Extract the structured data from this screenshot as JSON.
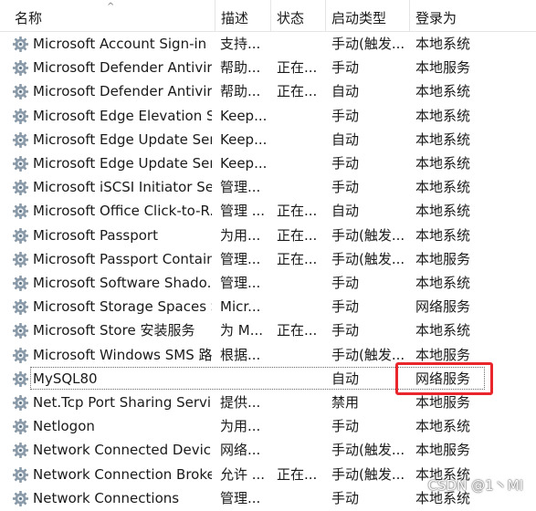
{
  "columns": {
    "name": "名称",
    "desc": "描述",
    "status": "状态",
    "startup": "启动类型",
    "logon": "登录为"
  },
  "sort_indicator": "^",
  "services": [
    {
      "name": "Microsoft Account Sign-in ...",
      "desc": "支持...",
      "status": "",
      "startup": "手动(触发...",
      "logon": "本地系统"
    },
    {
      "name": "Microsoft Defender Antivir...",
      "desc": "帮助...",
      "status": "正在...",
      "startup": "手动",
      "logon": "本地服务"
    },
    {
      "name": "Microsoft Defender Antivir...",
      "desc": "帮助...",
      "status": "正在...",
      "startup": "自动",
      "logon": "本地系统"
    },
    {
      "name": "Microsoft Edge Elevation S...",
      "desc": "Keep...",
      "status": "",
      "startup": "手动",
      "logon": "本地系统"
    },
    {
      "name": "Microsoft Edge Update Ser...",
      "desc": "Keep...",
      "status": "",
      "startup": "自动",
      "logon": "本地系统"
    },
    {
      "name": "Microsoft Edge Update Ser...",
      "desc": "Keep...",
      "status": "",
      "startup": "手动",
      "logon": "本地系统"
    },
    {
      "name": "Microsoft iSCSI Initiator Ser...",
      "desc": "管理...",
      "status": "",
      "startup": "手动",
      "logon": "本地系统"
    },
    {
      "name": "Microsoft Office Click-to-R...",
      "desc": "管理 ...",
      "status": "正在...",
      "startup": "自动",
      "logon": "本地系统"
    },
    {
      "name": "Microsoft Passport",
      "desc": "为用...",
      "status": "正在...",
      "startup": "手动(触发...",
      "logon": "本地系统"
    },
    {
      "name": "Microsoft Passport Container",
      "desc": "管理...",
      "status": "正在...",
      "startup": "手动(触发...",
      "logon": "本地服务"
    },
    {
      "name": "Microsoft Software Shado...",
      "desc": "管理...",
      "status": "",
      "startup": "手动",
      "logon": "本地系统"
    },
    {
      "name": "Microsoft Storage Spaces S...",
      "desc": "Micr...",
      "status": "",
      "startup": "手动",
      "logon": "网络服务"
    },
    {
      "name": "Microsoft Store 安装服务",
      "desc": "为 M...",
      "status": "正在...",
      "startup": "手动",
      "logon": "本地系统"
    },
    {
      "name": "Microsoft Windows SMS 路...",
      "desc": "根据...",
      "status": "",
      "startup": "手动(触发...",
      "logon": "本地服务"
    },
    {
      "name": "MySQL80",
      "desc": "",
      "status": "",
      "startup": "自动",
      "logon": "网络服务"
    },
    {
      "name": "Net.Tcp Port Sharing Service",
      "desc": "提供...",
      "status": "",
      "startup": "禁用",
      "logon": "本地服务"
    },
    {
      "name": "Netlogon",
      "desc": "为用...",
      "status": "",
      "startup": "手动",
      "logon": "本地系统"
    },
    {
      "name": "Network Connected Devic...",
      "desc": "网络...",
      "status": "",
      "startup": "手动(触发...",
      "logon": "本地服务"
    },
    {
      "name": "Network Connection Broker",
      "desc": "允许 ...",
      "status": "正在...",
      "startup": "手动(触发...",
      "logon": "本地系统"
    },
    {
      "name": "Network Connections",
      "desc": "管理...",
      "status": "",
      "startup": "手动",
      "logon": "本地系统"
    }
  ],
  "focused_index": 14,
  "watermark": "CSDN @1丶MI",
  "colors": {
    "highlight": "#e8262b",
    "header_separator": "#e5e5e5",
    "gear": "#8a9aa8"
  }
}
